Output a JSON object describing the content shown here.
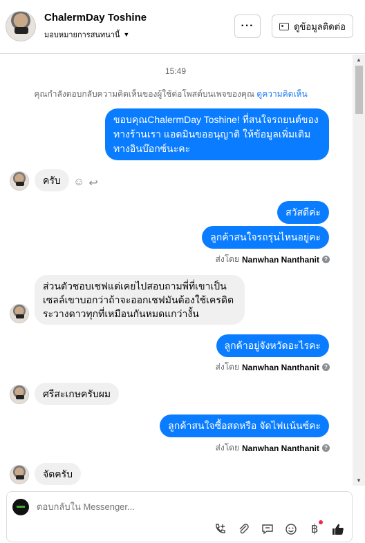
{
  "header": {
    "contact_name": "ChalermDay Toshine",
    "assignee": "มอบหมายการสนทนานี้",
    "more_label": "···",
    "contact_info_label": "ดูข้อมูลติดต่อ"
  },
  "chat": {
    "timestamp": "15:49",
    "notice_text": "คุณกำลังตอบกลับความคิดเห็นของผู้ใช้ต่อโพสต์บนเพจของคุณ ",
    "notice_link": "ดูความคิดเห็น",
    "messages": {
      "m1": "ขอบคุณChalermDay Toshine! ที่สนใจรถยนต์ของทางร้านเรา แอดมินขออนุญาติ ให้ข้อมูลเพิ่มเติมทางอินบ๊อกซ์นะคะ",
      "m2": "ครับ",
      "m3": "สวัสดีค่ะ",
      "m4": "ลูกค้าสนใจรถรุ่นไหนอยู่คะ",
      "m5": "ส่วนตัวชอบเชฟแต่เคยไปสอบถามพี่ที่เขาเป็นเซลล์เขาบอกว่าถ้าจะออกเชฟมันต้องใช้เครดิตระวางดาวทุกที่เหมือนกันหมดแกว่างั้น",
      "m6": "ลูกค้าอยู่จังหวัดอะไรคะ",
      "m7": "ศรีสะเกษครับผม",
      "m8": "ลูกค้าสนใจซื้อสดหรือ จัดไฟแน้นซ์คะ",
      "m9": "จัดครับ"
    },
    "sent_by_prefix": "ส่งโดย",
    "sent_by_name": "Nanwhan Nanthanit"
  },
  "composer": {
    "placeholder": "ตอบกลับใน Messenger..."
  },
  "colors": {
    "outgoing_bubble": "#0a7cff",
    "incoming_bubble": "#f0f0f0",
    "link": "#1877f2"
  },
  "icons": [
    "chevron-down-icon",
    "contact-card-icon",
    "emoji-icon",
    "reply-icon",
    "help-icon",
    "phone-add-icon",
    "attachment-icon",
    "saved-reply-icon",
    "emoji-picker-icon",
    "payment-icon",
    "like-icon"
  ]
}
